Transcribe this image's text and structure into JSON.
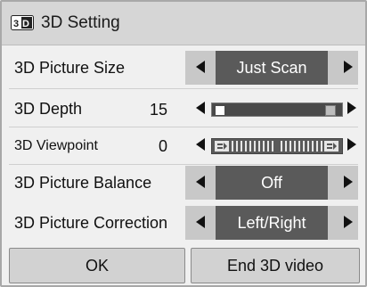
{
  "dialog": {
    "title": "3D Setting",
    "title_icon": "3d-badge-icon"
  },
  "rows": [
    {
      "label": "3D Picture Size",
      "type": "selector",
      "value": "Just Scan"
    },
    {
      "label": "3D Depth",
      "type": "slider",
      "value": "15",
      "level": 0.15
    },
    {
      "label": "3D Viewpoint",
      "type": "viewpoint",
      "value": "0"
    },
    {
      "label": "3D Picture Balance",
      "type": "selector",
      "value": "Off"
    },
    {
      "label": "3D Picture Correction",
      "type": "selector",
      "value": "Left/Right"
    }
  ],
  "buttons": {
    "ok": "OK",
    "end": "End 3D video"
  },
  "colors": {
    "selected_value_bg": "#5a5a5a",
    "selector_bg": "#c8c8c8",
    "title_bar_bg": "#d6d6d6",
    "button_bg": "#d2d2d2"
  }
}
